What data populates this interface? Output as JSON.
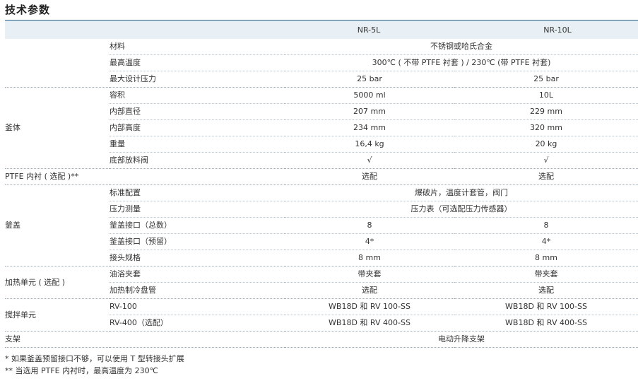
{
  "title": "技术参数",
  "header": {
    "col_a": "NR-5L",
    "col_b": "NR-10L"
  },
  "groups": [
    {
      "name": "",
      "rows": [
        {
          "label": "材料",
          "span": "不锈钢或哈氏合金"
        },
        {
          "label": "最高温度",
          "span": "300℃ ( 不带 PTFE 衬套 ) / 230℃ (带 PTFE 衬套)"
        },
        {
          "label": "最大设计压力",
          "a": "25 bar",
          "b": "25 bar"
        }
      ]
    },
    {
      "name": "釜体",
      "rows": [
        {
          "label": "容积",
          "a": "5000 ml",
          "b": "10L"
        },
        {
          "label": "内部直径",
          "a": "207 mm",
          "b": "229 mm"
        },
        {
          "label": "内部高度",
          "a": "234 mm",
          "b": "320 mm"
        },
        {
          "label": "重量",
          "a": "16,4 kg",
          "b": "20 kg"
        },
        {
          "label": "底部放料阀",
          "a": "√",
          "b": "√"
        }
      ]
    },
    {
      "name": "PTFE 内衬 ( 选配 )**",
      "rows": [
        {
          "label": "",
          "a": "选配",
          "b": "选配"
        }
      ]
    },
    {
      "name": "釜盖",
      "rows": [
        {
          "label": "标准配置",
          "span": "爆破片，温度计套管，阀门"
        },
        {
          "label": "压力测量",
          "span": "压力表（可选配压力传感器）"
        },
        {
          "label": "釜盖接口（总数）",
          "a": "8",
          "b": "8"
        },
        {
          "label": "釜盖接口（预留）",
          "a": "4*",
          "b": "4*"
        },
        {
          "label": "接头规格",
          "a": "8 mm",
          "b": "8 mm"
        }
      ]
    },
    {
      "name": "加热单元 ( 选配 )",
      "rows": [
        {
          "label": "油浴夹套",
          "a": "带夹套",
          "b": "带夹套"
        },
        {
          "label": "加热制冷盘管",
          "a": "选配",
          "b": "选配"
        }
      ]
    },
    {
      "name": "搅拌单元",
      "rows": [
        {
          "label": "RV-100",
          "a": "WB18D 和 RV 100-SS",
          "b": "WB18D 和 RV 100-SS"
        },
        {
          "label": "RV-400（选配）",
          "a": "WB18D 和 RV 400-SS",
          "b": "WB18D 和 RV 400-SS"
        }
      ]
    },
    {
      "name": "支架",
      "rows": [
        {
          "label": "",
          "span": "电动升降支架"
        }
      ]
    }
  ],
  "notes": [
    "*  如果釜盖预留接口不够，可以使用 T 型转接头扩展",
    "** 当选用 PTFE 内衬时，最高温度为 230℃"
  ],
  "colors": {
    "header_band": "#e8f0f5",
    "header_rule": "#1f5c87",
    "divider": "#b9c3cc"
  }
}
